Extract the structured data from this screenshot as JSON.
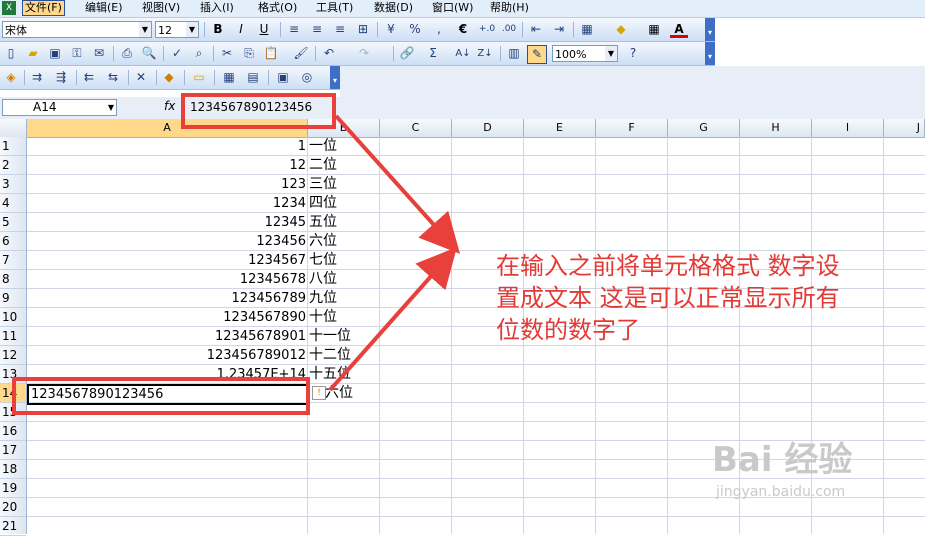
{
  "menu": {
    "items": [
      "文件(F)",
      "编辑(E)",
      "视图(V)",
      "插入(I)",
      "格式(O)",
      "工具(T)",
      "数据(D)",
      "窗口(W)",
      "帮助(H)"
    ]
  },
  "toolbar": {
    "font_name": "宋体",
    "font_size": "12",
    "zoom": "100%",
    "bold": "B",
    "italic": "I",
    "underline": "U",
    "percent": "%",
    "comma": ",",
    "euro": "€",
    "sigma": "Σ"
  },
  "formula_bar": {
    "name_box": "A14",
    "fx": "fx",
    "value": "1234567890123456"
  },
  "grid": {
    "columns": [
      "A",
      "B",
      "C",
      "D",
      "E",
      "F",
      "G",
      "H",
      "I",
      "J"
    ],
    "row_numbers": [
      "1",
      "2",
      "3",
      "4",
      "5",
      "6",
      "7",
      "8",
      "9",
      "10",
      "11",
      "12",
      "13",
      "14",
      "15",
      "16",
      "17",
      "18",
      "19",
      "20",
      "21"
    ],
    "rows": [
      {
        "a": "1",
        "b": "一位"
      },
      {
        "a": "12",
        "b": "二位"
      },
      {
        "a": "123",
        "b": "三位"
      },
      {
        "a": "1234",
        "b": "四位"
      },
      {
        "a": "12345",
        "b": "五位"
      },
      {
        "a": "123456",
        "b": "六位"
      },
      {
        "a": "1234567",
        "b": "七位"
      },
      {
        "a": "12345678",
        "b": "八位"
      },
      {
        "a": "123456789",
        "b": "九位"
      },
      {
        "a": "1234567890",
        "b": "十位"
      },
      {
        "a": "12345678901",
        "b": "十一位"
      },
      {
        "a": "123456789012",
        "b": "十二位"
      },
      {
        "a": "1.23457E+14",
        "b": "十五位"
      }
    ],
    "selected_cell": {
      "value": "1234567890123456",
      "b": "六位"
    }
  },
  "annotation": {
    "line1": "在输入之前将单元格格式 数字设",
    "line2": "置成文本 这是可以正常显示所有",
    "line3": "位数的数字了"
  },
  "watermark": {
    "brand": "Bai 经验",
    "url": "jingyan.baidu.com"
  },
  "colors": {
    "annotation_red": "#e23b36",
    "menu_bg": "#e3eefb"
  }
}
